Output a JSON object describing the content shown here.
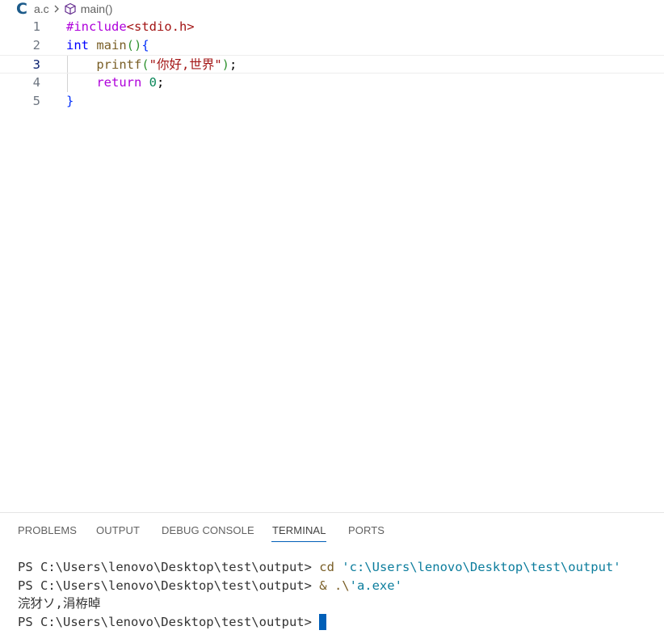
{
  "breadcrumb": {
    "lang_icon": "C",
    "file": "a.c",
    "symbol": "main()"
  },
  "editor": {
    "current_line": 3,
    "lines": [
      {
        "number": "1",
        "tokens": [
          {
            "text": "#include",
            "kind": "directive"
          },
          {
            "text": "<stdio.h>",
            "kind": "header"
          }
        ]
      },
      {
        "number": "2",
        "tokens": [
          {
            "text": "int",
            "kind": "keyword"
          },
          {
            "text": " main",
            "kind": "func"
          },
          {
            "text": "()",
            "kind": "brace-2"
          },
          {
            "text": "{",
            "kind": "brace-1"
          }
        ]
      },
      {
        "number": "3",
        "tokens": [
          {
            "text": "    printf",
            "kind": "func"
          },
          {
            "text": "(",
            "kind": "brace-2"
          },
          {
            "text": "\"你好,世界\"",
            "kind": "string"
          },
          {
            "text": ")",
            "kind": "brace-2"
          },
          {
            "text": ";",
            "kind": "punct"
          }
        ]
      },
      {
        "number": "4",
        "tokens": [
          {
            "text": "    return",
            "kind": "control"
          },
          {
            "text": " ",
            "kind": "punct"
          },
          {
            "text": "0",
            "kind": "number"
          },
          {
            "text": ";",
            "kind": "punct"
          }
        ]
      },
      {
        "number": "5",
        "tokens": [
          {
            "text": "}",
            "kind": "brace-1"
          }
        ]
      }
    ]
  },
  "panel": {
    "tabs": [
      {
        "label": "PROBLEMS",
        "active": false
      },
      {
        "label": "OUTPUT",
        "active": false
      },
      {
        "label": "DEBUG CONSOLE",
        "active": false
      },
      {
        "label": "TERMINAL",
        "active": true
      },
      {
        "label": "PORTS",
        "active": false
      }
    ],
    "terminal": {
      "line1_prompt": "PS C:\\Users\\lenovo\\Desktop\\test\\output> ",
      "line1_cmd": "cd",
      "line1_arg": " 'c:\\Users\\lenovo\\Desktop\\test\\output'",
      "line2_prompt": "PS C:\\Users\\lenovo\\Desktop\\test\\output> ",
      "line2_cmd": "& .\\",
      "line2_arg": "'a.exe'",
      "line3_output": "浣犲ソ,涓栫晫",
      "line4_prompt": "PS C:\\Users\\lenovo\\Desktop\\test\\output> "
    }
  },
  "colors": {
    "accent": "#005fb8",
    "c_icon": "#1c5b8a"
  },
  "icons": {
    "breadcrumb_separator": "chevron-right-icon",
    "symbol": "cube-icon"
  }
}
